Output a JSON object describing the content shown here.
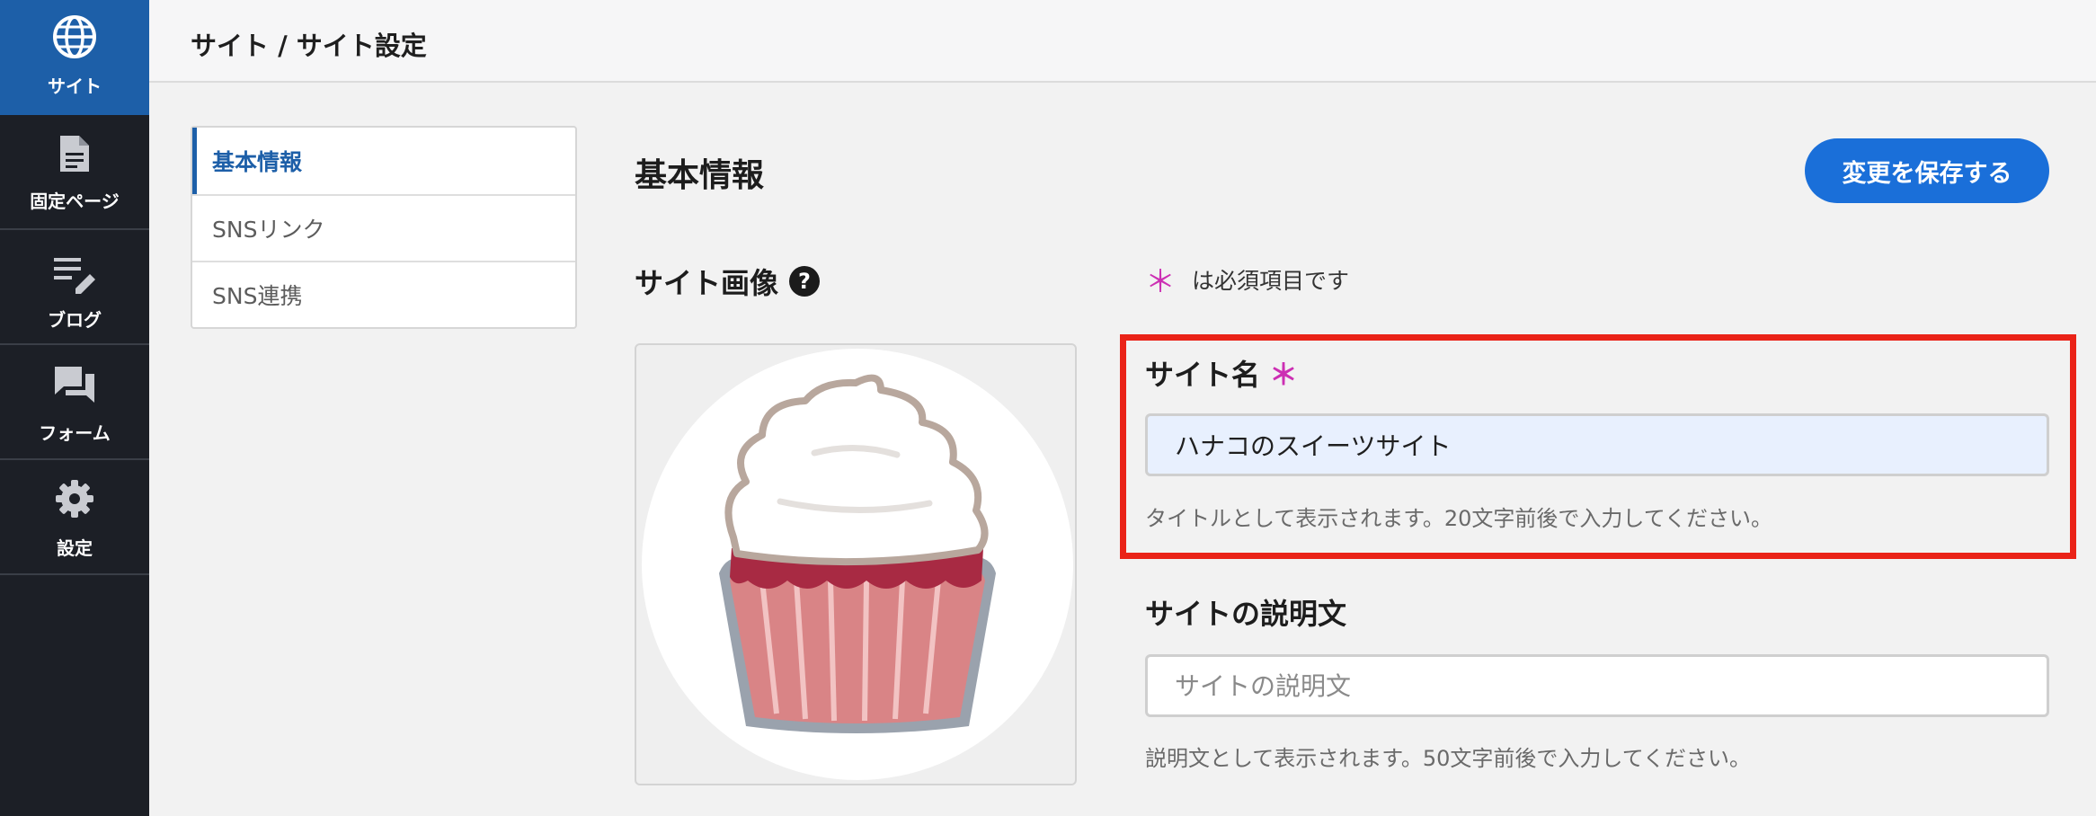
{
  "nav": {
    "items": [
      {
        "label": "サイト",
        "icon": "globe-icon",
        "active": true
      },
      {
        "label": "固定ページ",
        "icon": "document-icon",
        "active": false
      },
      {
        "label": "ブログ",
        "icon": "edit-list-icon",
        "active": false
      },
      {
        "label": "フォーム",
        "icon": "forum-icon",
        "active": false
      },
      {
        "label": "設定",
        "icon": "gear-icon",
        "active": false
      }
    ]
  },
  "header": {
    "breadcrumb": "サイト / サイト設定"
  },
  "submenu": {
    "items": [
      {
        "label": "基本情報",
        "active": true
      },
      {
        "label": "SNSリンク",
        "active": false
      },
      {
        "label": "SNS連携",
        "active": false
      }
    ]
  },
  "main": {
    "title": "基本情報",
    "save_label": "変更を保存する",
    "image_title": "サイト画像",
    "help_icon": "question-circle-icon",
    "image_alt": "cupcake-illustration",
    "required_star": "＊",
    "required_note": "は必須項目です",
    "site_name": {
      "label": "サイト名",
      "value": "ハナコのスイーツサイト",
      "hint": "タイトルとして表示されます。20文字前後で入力してください。"
    },
    "site_description": {
      "label": "サイトの説明文",
      "value": "",
      "placeholder": "サイトの説明文",
      "hint": "説明文として表示されます。50文字前後で入力してください。"
    }
  },
  "colors": {
    "nav_bg": "#1c1f26",
    "nav_active": "#1d5fa8",
    "accent": "#1a6fd9",
    "required": "#cc2fb3",
    "highlight_border": "#ea2318",
    "filled_input_bg": "#e8f0fe"
  }
}
